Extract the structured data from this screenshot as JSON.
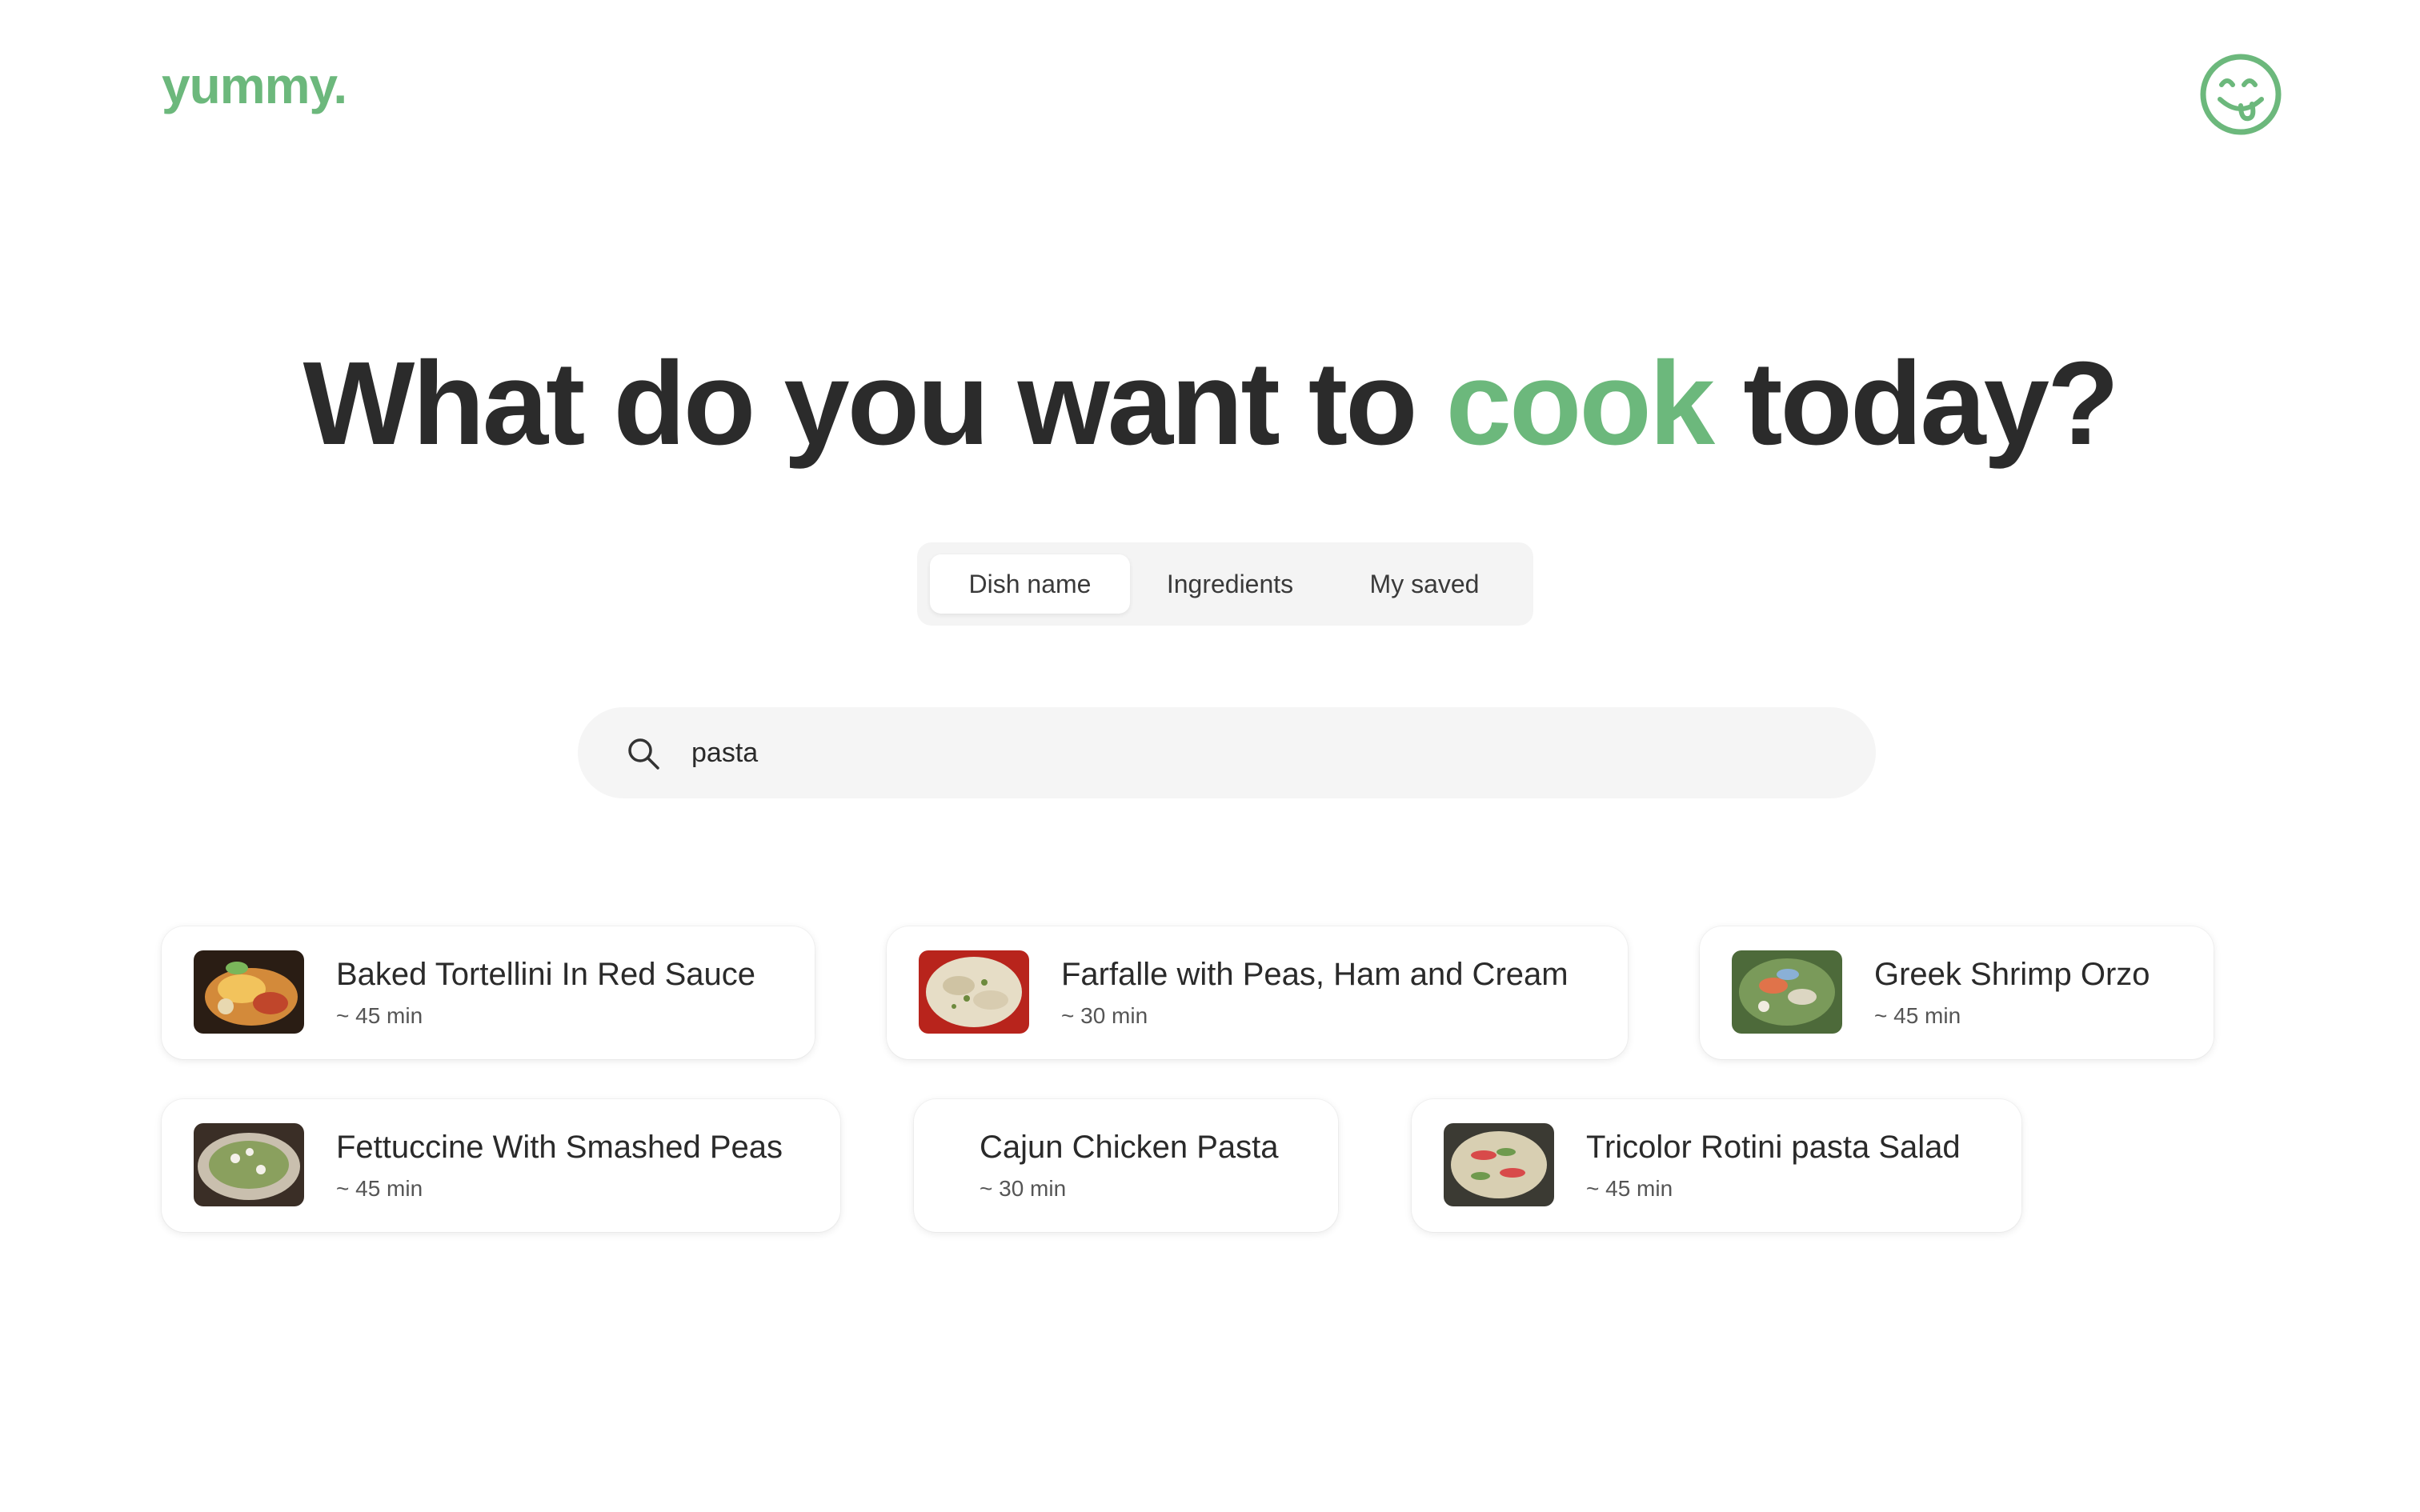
{
  "brand": {
    "logo": "yummy.",
    "accent_color": "#6cb87c",
    "avatar_icon": "smiley-tongue-icon"
  },
  "headline": {
    "before": "What do you want to ",
    "highlight": "cook",
    "after": " today?"
  },
  "tabs": [
    {
      "label": "Dish name",
      "active": true
    },
    {
      "label": "Ingredients",
      "active": false
    },
    {
      "label": "My saved",
      "active": false
    }
  ],
  "search": {
    "icon": "search-icon",
    "value": "pasta",
    "placeholder": ""
  },
  "results": [
    {
      "title": "Baked Tortellini In Red Sauce",
      "time": "~ 45 min",
      "has_image": true
    },
    {
      "title": "Farfalle with Peas, Ham and Cream",
      "time": "~ 30 min",
      "has_image": true
    },
    {
      "title": "Greek Shrimp Orzo",
      "time": "~ 45 min",
      "has_image": true
    },
    {
      "title": "Fettuccine With Smashed Peas",
      "time": "~ 45 min",
      "has_image": true
    },
    {
      "title": "Cajun Chicken Pasta",
      "time": "~ 30 min",
      "has_image": false
    },
    {
      "title": "Tricolor Rotini pasta Salad",
      "time": "~ 45 min",
      "has_image": true
    }
  ]
}
